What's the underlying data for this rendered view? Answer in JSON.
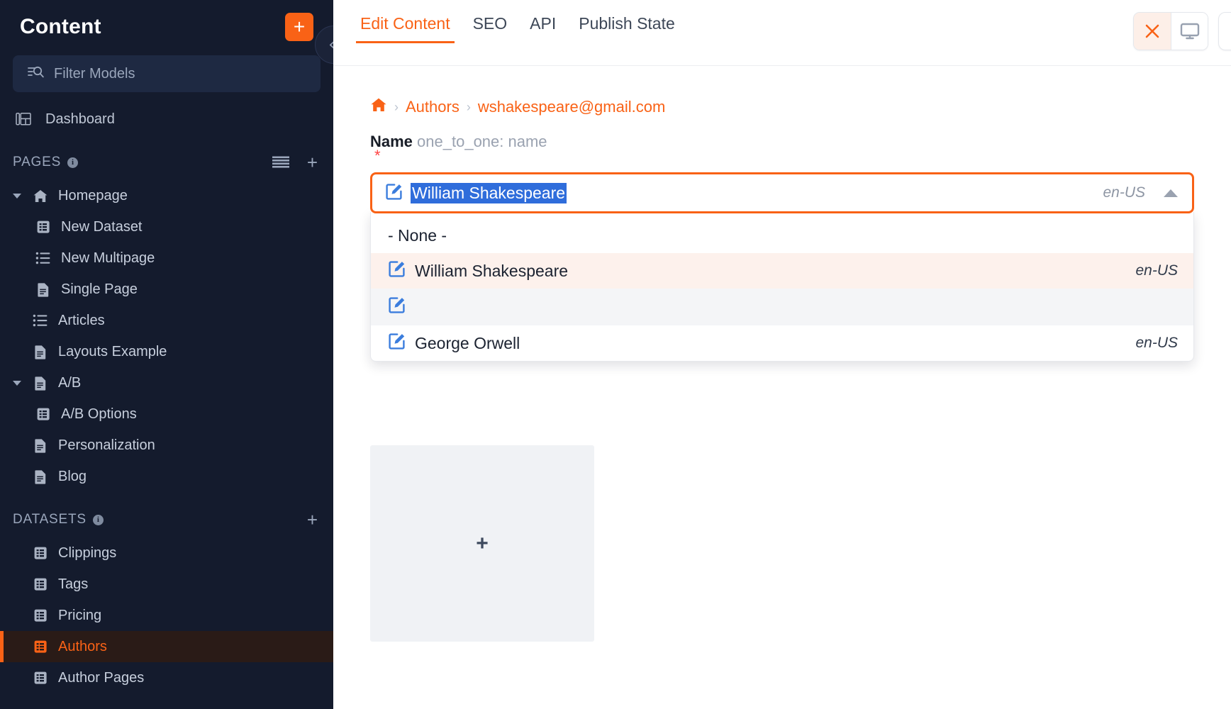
{
  "theme": {
    "accent": "#f96216",
    "sidebar_bg": "#141b2d",
    "selection_blue": "#2f6ddb",
    "highlight_row": "#fdf1ec"
  },
  "sidebar": {
    "title": "Content",
    "add_button_label": "+",
    "filter": {
      "placeholder": "Filter Models",
      "icon": "filter-search-icon"
    },
    "dashboard": {
      "label": "Dashboard",
      "icon": "dashboard-icon"
    },
    "sections": [
      {
        "name": "PAGES",
        "info": "i",
        "list_icon": "list-view-icon",
        "add_icon": "+",
        "items": [
          {
            "label": "Homepage",
            "icon": "home-icon",
            "depth": 0,
            "caret": true,
            "active": false
          },
          {
            "label": "New Dataset",
            "icon": "dataset-icon",
            "depth": 1,
            "caret": false,
            "active": false
          },
          {
            "label": "New Multipage",
            "icon": "multipage-icon",
            "depth": 1,
            "caret": false,
            "active": false
          },
          {
            "label": "Single Page",
            "icon": "page-icon",
            "depth": 1,
            "caret": false,
            "active": false
          },
          {
            "label": "Articles",
            "icon": "multipage-icon",
            "depth": 0,
            "caret": false,
            "active": false
          },
          {
            "label": "Layouts Example",
            "icon": "page-icon",
            "depth": 0,
            "caret": false,
            "active": false
          },
          {
            "label": "A/B",
            "icon": "page-icon",
            "depth": 0,
            "caret": true,
            "active": false
          },
          {
            "label": "A/B Options",
            "icon": "dataset-icon",
            "depth": 1,
            "caret": false,
            "active": false
          },
          {
            "label": "Personalization",
            "icon": "page-icon",
            "depth": 0,
            "caret": false,
            "active": false
          },
          {
            "label": "Blog",
            "icon": "page-icon",
            "depth": 0,
            "caret": false,
            "active": false
          }
        ]
      },
      {
        "name": "DATASETS",
        "info": "i",
        "list_icon": "",
        "add_icon": "+",
        "items": [
          {
            "label": "Clippings",
            "icon": "dataset-icon",
            "depth": 0,
            "caret": false,
            "active": false
          },
          {
            "label": "Tags",
            "icon": "dataset-icon",
            "depth": 0,
            "caret": false,
            "active": false
          },
          {
            "label": "Pricing",
            "icon": "dataset-icon",
            "depth": 0,
            "caret": false,
            "active": false
          },
          {
            "label": "Authors",
            "icon": "dataset-icon",
            "depth": 0,
            "caret": false,
            "active": true
          },
          {
            "label": "Author Pages",
            "icon": "dataset-icon",
            "depth": 0,
            "caret": false,
            "active": false
          }
        ]
      }
    ],
    "collapse_button": {
      "icon": "chevron-double-left-icon",
      "glyph": "«"
    }
  },
  "topbar": {
    "tabs": [
      {
        "label": "Edit Content",
        "active": true
      },
      {
        "label": "SEO",
        "active": false
      },
      {
        "label": "API",
        "active": false
      },
      {
        "label": "Publish State",
        "active": false
      }
    ],
    "actions": [
      {
        "name": "close-preview-button",
        "icon": "close-icon",
        "selected": true
      },
      {
        "name": "desktop-view-button",
        "icon": "desktop-icon",
        "selected": false
      }
    ],
    "partial_action": {
      "name": "tablet-view-button",
      "icon": "tablet-icon"
    }
  },
  "breadcrumb": {
    "home_icon": "home-icon",
    "separator": "›",
    "items": [
      {
        "label": "Authors"
      },
      {
        "label": "wshakespeare@gmail.com"
      }
    ]
  },
  "field": {
    "label": "Name",
    "hint": "one_to_one: name",
    "required_marker": "*"
  },
  "combo": {
    "value": "William Shakespeare",
    "icon": "edit-link-icon",
    "locale": "en-US",
    "caret_icon": "caret-up-icon",
    "open": true
  },
  "dropdown": {
    "options": [
      {
        "label": "- None -",
        "locale": "",
        "icon": "",
        "state": "none"
      },
      {
        "label": "William Shakespeare",
        "locale": "en-US",
        "icon": "edit-link-icon",
        "state": "highlighted"
      },
      {
        "label": "",
        "locale": "",
        "icon": "edit-link-icon",
        "state": "alt"
      },
      {
        "label": "George Orwell",
        "locale": "en-US",
        "icon": "edit-link-icon",
        "state": "normal"
      }
    ]
  },
  "media": {
    "add_icon": "plus-icon",
    "add_label": "+"
  }
}
